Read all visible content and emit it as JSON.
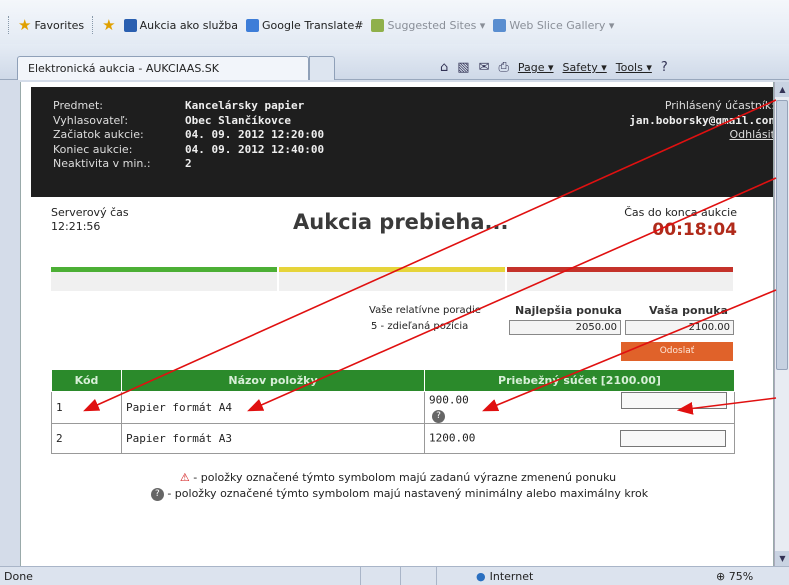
{
  "favorites": {
    "label": "Favorites",
    "items": [
      {
        "label": "Aukcia ako služba",
        "muted": false
      },
      {
        "label": "Google Translate#",
        "muted": false
      },
      {
        "label": "Suggested Sites ▾",
        "muted": true
      },
      {
        "label": "Web Slice Gallery ▾",
        "muted": true
      }
    ]
  },
  "tab": {
    "title": "Elektronická aukcia - AUKCIAAS.SK"
  },
  "commandbar": {
    "page": "Page ▾",
    "safety": "Safety ▾",
    "tools": "Tools ▾"
  },
  "header": {
    "labels": [
      "Predmet:",
      "Vyhlasovateľ:",
      "Začiatok aukcie:",
      "Koniec aukcie:",
      "Neaktivita v min.:"
    ],
    "values": [
      "Kancelársky papier",
      "Obec Slančíkovce",
      "04. 09. 2012 12:20:00",
      "04. 09. 2012 12:40:00",
      "2"
    ],
    "user_label": "Prihlásený účastník:",
    "user_email": "jan.boborsky@gmail.con",
    "logout": "Odhlásiť"
  },
  "server": {
    "label": "Serverový čas",
    "time": "12:21:56"
  },
  "status": "Aukcia prebieha...",
  "countdown": {
    "label": "Čas do konca aukcie",
    "value": "00:18:04"
  },
  "bars": {
    "colors": [
      "#4caf35",
      "#e6d43a",
      "#c4322a"
    ]
  },
  "bid": {
    "relative_label": "Vaše relatívne poradie",
    "rank": "5 - zdieľaná pozícia",
    "best_label": "Najlepšia ponuka",
    "best_value": "2050.00",
    "yours_label": "Vaša ponuka",
    "yours_value": "2100.00",
    "send": "Odoslať"
  },
  "table": {
    "headers": [
      "Kód",
      "Názov položky",
      "Priebežný súčet [2100.00]"
    ],
    "rows": [
      {
        "code": "1",
        "name": "Papier formát A4",
        "sum": "900.00"
      },
      {
        "code": "2",
        "name": "Papier formát A3",
        "sum": "1200.00"
      }
    ]
  },
  "legend": {
    "line1": " - položky označené týmto symbolom majú zadanú výrazne zmenenú ponuku",
    "line2": " - položky označené týmto symbolom majú nastavený minimálny alebo maximálny krok"
  },
  "statusbar": {
    "done": "Done",
    "zone": "Internet",
    "zoom": "75%"
  }
}
